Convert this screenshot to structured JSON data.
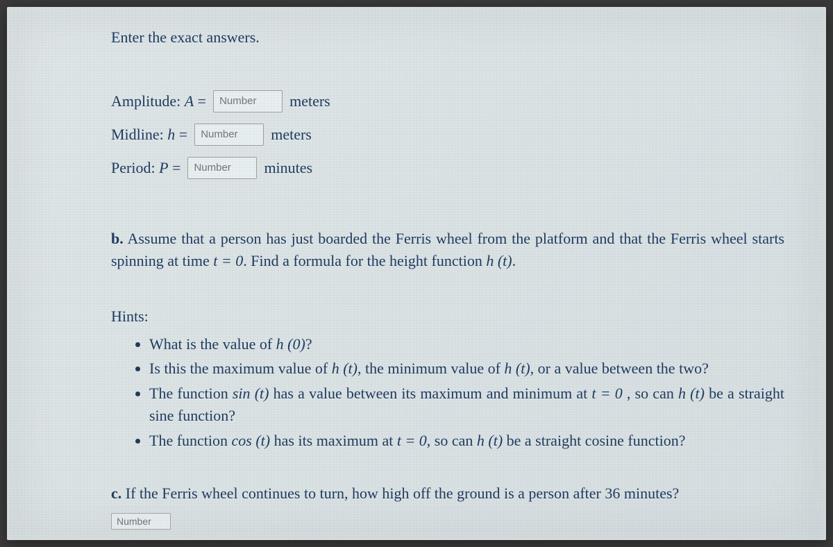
{
  "instruction": "Enter the exact answers.",
  "amplitude": {
    "label_prefix": "Amplitude: ",
    "var": "A",
    "equals": " = ",
    "placeholder": "Number",
    "unit": "meters"
  },
  "midline": {
    "label_prefix": "Midline: ",
    "var": "h",
    "equals": " = ",
    "placeholder": "Number",
    "unit": "meters"
  },
  "period": {
    "label_prefix": "Period: ",
    "var": "P",
    "equals": " = ",
    "placeholder": "Number",
    "unit": "minutes"
  },
  "part_b": {
    "letter": "b.",
    "text_1": " Assume that a person has just boarded the Ferris wheel from the platform and that the Ferris wheel starts spinning at time ",
    "t_eq_0": "t = 0",
    "text_2": ". Find a formula for the height function ",
    "h_of_t": "h (t)",
    "text_3": "."
  },
  "hints_label": "Hints:",
  "hints": {
    "h1_a": "What is the value of ",
    "h1_b": "h (0)",
    "h1_c": "?",
    "h2_a": "Is this the maximum value of ",
    "h2_b": "h (t)",
    "h2_c": ", the minimum value of ",
    "h2_d": "h (t)",
    "h2_e": ", or a value between the two?",
    "h3_a": "The function ",
    "h3_b": "sin (t)",
    "h3_c": " has a value between its maximum and minimum at ",
    "h3_d": "t = 0",
    "h3_e": " , so can ",
    "h3_f": "h (t)",
    "h3_g": " be a straight sine function?",
    "h4_a": "The function ",
    "h4_b": "cos (t)",
    "h4_c": " has its maximum at ",
    "h4_d": "t = 0",
    "h4_e": ", so can ",
    "h4_f": "h (t)",
    "h4_g": " be a straight cosine function?"
  },
  "part_c": {
    "letter": "c.",
    "text": " If the Ferris wheel continues to turn, how high off the ground is a person after 36 minutes?",
    "placeholder": "Number"
  }
}
